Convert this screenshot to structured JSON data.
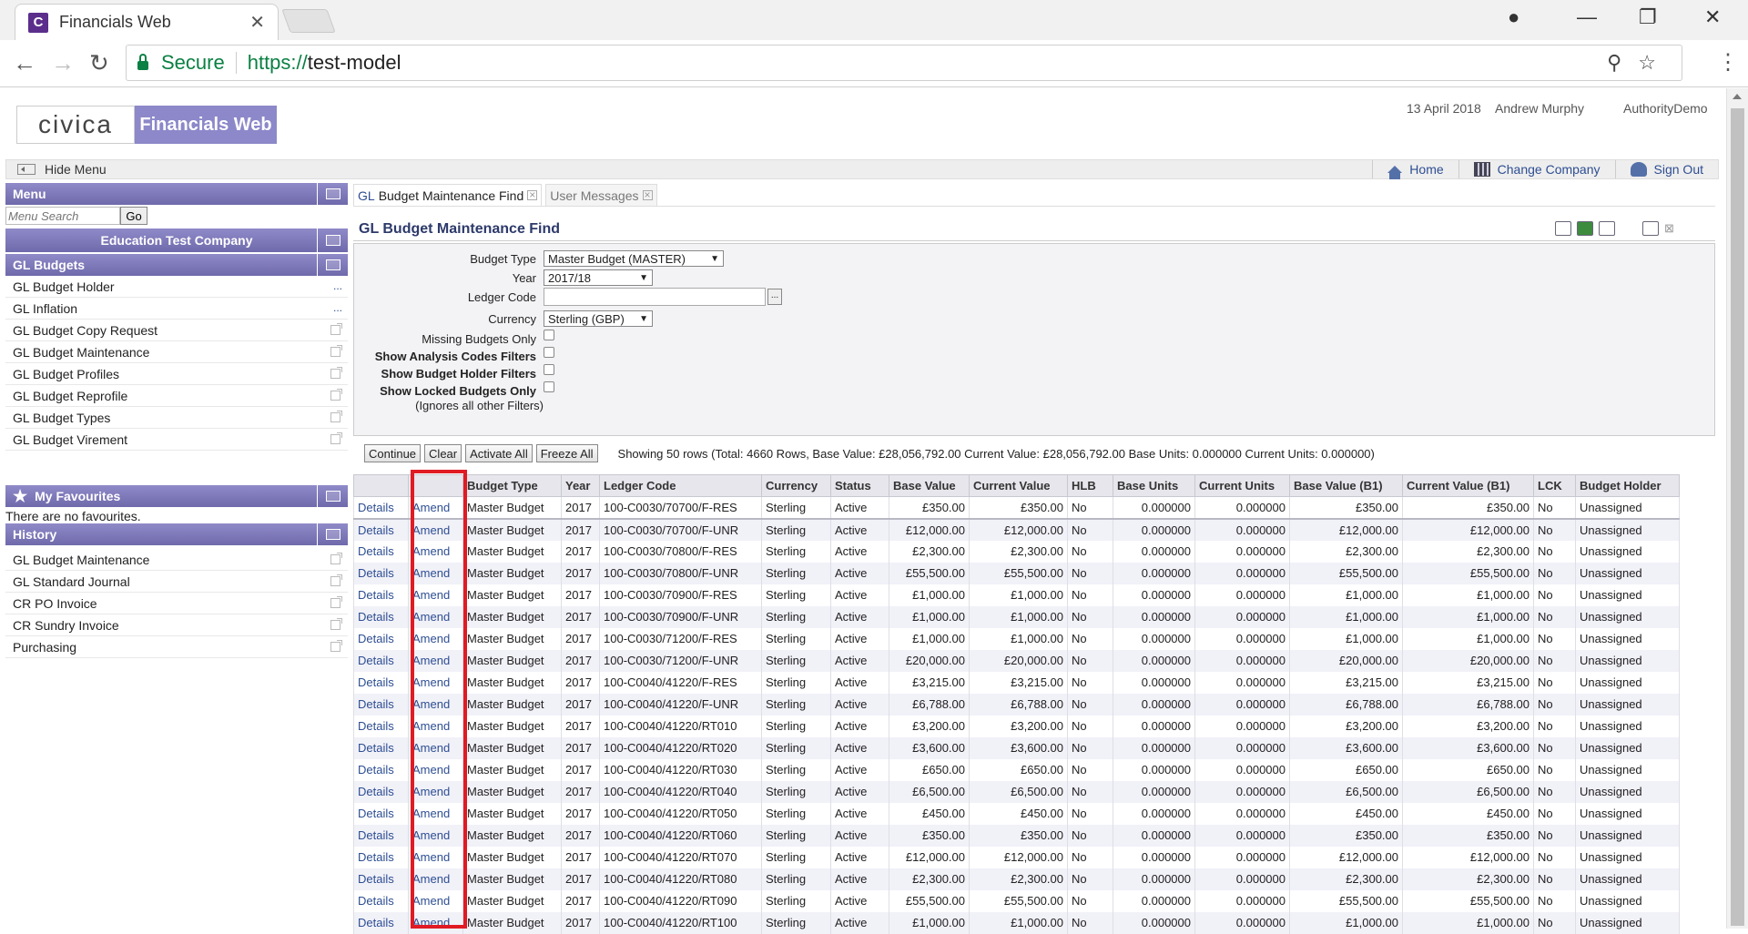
{
  "browser": {
    "tab_title": "Financials Web",
    "favicon_letter": "C",
    "secure_label": "Secure",
    "url_scheme": "https://",
    "url_host": "test-model"
  },
  "header": {
    "logo_text": "civica",
    "product_name": "Financials Web",
    "date": "13 April 2018",
    "user": "Andrew Murphy",
    "authority": "AuthorityDemo",
    "hide_menu": "Hide Menu",
    "links": {
      "home": "Home",
      "change_company": "Change Company",
      "sign_out": "Sign Out"
    }
  },
  "sidebar": {
    "menu_title": "Menu",
    "search_placeholder": "Menu Search",
    "go": "Go",
    "company": "Education Test Company",
    "group_title": "GL Budgets",
    "items": [
      {
        "label": "GL Budget Holder",
        "action": "..."
      },
      {
        "label": "GL Inflation",
        "action": "..."
      },
      {
        "label": "GL Budget Copy Request"
      },
      {
        "label": "GL Budget Maintenance"
      },
      {
        "label": "GL Budget Profiles"
      },
      {
        "label": "GL Budget Reprofile"
      },
      {
        "label": "GL Budget Types"
      },
      {
        "label": "GL Budget Virement"
      }
    ],
    "favourites_title": "My Favourites",
    "no_favourites": "There are no favourites.",
    "history_title": "History",
    "history": [
      "GL Budget Maintenance",
      "GL Standard Journal",
      "CR PO Invoice",
      "CR Sundry Invoice",
      "Purchasing"
    ]
  },
  "tabs": {
    "active_prefix": "GL",
    "active_label": "Budget Maintenance Find",
    "second": "User Messages"
  },
  "page_title": "GL Budget Maintenance Find",
  "form": {
    "budget_type_label": "Budget Type",
    "budget_type_value": "Master Budget (MASTER)",
    "year_label": "Year",
    "year_value": "2017/18",
    "ledger_code_label": "Ledger Code",
    "ledger_code_value": "",
    "currency_label": "Currency",
    "currency_value": "Sterling (GBP)",
    "missing_label": "Missing Budgets Only",
    "analysis_label": "Show Analysis Codes Filters",
    "holder_label": "Show Budget Holder Filters",
    "locked_label": "Show Locked Budgets Only",
    "ignore_note": "(Ignores all other Filters)"
  },
  "actions": {
    "continue": "Continue",
    "clear": "Clear",
    "activate_all": "Activate All",
    "freeze_all": "Freeze All",
    "summary": "Showing 50 rows (Total: 4660 Rows, Base Value: £28,056,792.00 Current Value: £28,056,792.00 Base Units: 0.000000 Current Units: 0.000000)"
  },
  "table": {
    "headers": [
      "",
      "",
      "Budget Type",
      "Year",
      "Ledger Code",
      "Currency",
      "Status",
      "Base Value",
      "Current Value",
      "HLB",
      "Base Units",
      "Current Units",
      "Base Value (B1)",
      "Current Value (B1)",
      "LCK",
      "Budget Holder"
    ],
    "details_label": "Details",
    "amend_label": "Amend",
    "rows": [
      [
        "Master Budget",
        "2017",
        "100-C0030/70700/F-RES",
        "Sterling",
        "Active",
        "£350.00",
        "£350.00",
        "No",
        "0.000000",
        "0.000000",
        "£350.00",
        "£350.00",
        "No",
        "Unassigned"
      ],
      [
        "Master Budget",
        "2017",
        "100-C0030/70700/F-UNR",
        "Sterling",
        "Active",
        "£12,000.00",
        "£12,000.00",
        "No",
        "0.000000",
        "0.000000",
        "£12,000.00",
        "£12,000.00",
        "No",
        "Unassigned"
      ],
      [
        "Master Budget",
        "2017",
        "100-C0030/70800/F-RES",
        "Sterling",
        "Active",
        "£2,300.00",
        "£2,300.00",
        "No",
        "0.000000",
        "0.000000",
        "£2,300.00",
        "£2,300.00",
        "No",
        "Unassigned"
      ],
      [
        "Master Budget",
        "2017",
        "100-C0030/70800/F-UNR",
        "Sterling",
        "Active",
        "£55,500.00",
        "£55,500.00",
        "No",
        "0.000000",
        "0.000000",
        "£55,500.00",
        "£55,500.00",
        "No",
        "Unassigned"
      ],
      [
        "Master Budget",
        "2017",
        "100-C0030/70900/F-RES",
        "Sterling",
        "Active",
        "£1,000.00",
        "£1,000.00",
        "No",
        "0.000000",
        "0.000000",
        "£1,000.00",
        "£1,000.00",
        "No",
        "Unassigned"
      ],
      [
        "Master Budget",
        "2017",
        "100-C0030/70900/F-UNR",
        "Sterling",
        "Active",
        "£1,000.00",
        "£1,000.00",
        "No",
        "0.000000",
        "0.000000",
        "£1,000.00",
        "£1,000.00",
        "No",
        "Unassigned"
      ],
      [
        "Master Budget",
        "2017",
        "100-C0030/71200/F-RES",
        "Sterling",
        "Active",
        "£1,000.00",
        "£1,000.00",
        "No",
        "0.000000",
        "0.000000",
        "£1,000.00",
        "£1,000.00",
        "No",
        "Unassigned"
      ],
      [
        "Master Budget",
        "2017",
        "100-C0030/71200/F-UNR",
        "Sterling",
        "Active",
        "£20,000.00",
        "£20,000.00",
        "No",
        "0.000000",
        "0.000000",
        "£20,000.00",
        "£20,000.00",
        "No",
        "Unassigned"
      ],
      [
        "Master Budget",
        "2017",
        "100-C0040/41220/F-RES",
        "Sterling",
        "Active",
        "£3,215.00",
        "£3,215.00",
        "No",
        "0.000000",
        "0.000000",
        "£3,215.00",
        "£3,215.00",
        "No",
        "Unassigned"
      ],
      [
        "Master Budget",
        "2017",
        "100-C0040/41220/F-UNR",
        "Sterling",
        "Active",
        "£6,788.00",
        "£6,788.00",
        "No",
        "0.000000",
        "0.000000",
        "£6,788.00",
        "£6,788.00",
        "No",
        "Unassigned"
      ],
      [
        "Master Budget",
        "2017",
        "100-C0040/41220/RT010",
        "Sterling",
        "Active",
        "£3,200.00",
        "£3,200.00",
        "No",
        "0.000000",
        "0.000000",
        "£3,200.00",
        "£3,200.00",
        "No",
        "Unassigned"
      ],
      [
        "Master Budget",
        "2017",
        "100-C0040/41220/RT020",
        "Sterling",
        "Active",
        "£3,600.00",
        "£3,600.00",
        "No",
        "0.000000",
        "0.000000",
        "£3,600.00",
        "£3,600.00",
        "No",
        "Unassigned"
      ],
      [
        "Master Budget",
        "2017",
        "100-C0040/41220/RT030",
        "Sterling",
        "Active",
        "£650.00",
        "£650.00",
        "No",
        "0.000000",
        "0.000000",
        "£650.00",
        "£650.00",
        "No",
        "Unassigned"
      ],
      [
        "Master Budget",
        "2017",
        "100-C0040/41220/RT040",
        "Sterling",
        "Active",
        "£6,500.00",
        "£6,500.00",
        "No",
        "0.000000",
        "0.000000",
        "£6,500.00",
        "£6,500.00",
        "No",
        "Unassigned"
      ],
      [
        "Master Budget",
        "2017",
        "100-C0040/41220/RT050",
        "Sterling",
        "Active",
        "£450.00",
        "£450.00",
        "No",
        "0.000000",
        "0.000000",
        "£450.00",
        "£450.00",
        "No",
        "Unassigned"
      ],
      [
        "Master Budget",
        "2017",
        "100-C0040/41220/RT060",
        "Sterling",
        "Active",
        "£350.00",
        "£350.00",
        "No",
        "0.000000",
        "0.000000",
        "£350.00",
        "£350.00",
        "No",
        "Unassigned"
      ],
      [
        "Master Budget",
        "2017",
        "100-C0040/41220/RT070",
        "Sterling",
        "Active",
        "£12,000.00",
        "£12,000.00",
        "No",
        "0.000000",
        "0.000000",
        "£12,000.00",
        "£12,000.00",
        "No",
        "Unassigned"
      ],
      [
        "Master Budget",
        "2017",
        "100-C0040/41220/RT080",
        "Sterling",
        "Active",
        "£2,300.00",
        "£2,300.00",
        "No",
        "0.000000",
        "0.000000",
        "£2,300.00",
        "£2,300.00",
        "No",
        "Unassigned"
      ],
      [
        "Master Budget",
        "2017",
        "100-C0040/41220/RT090",
        "Sterling",
        "Active",
        "£55,500.00",
        "£55,500.00",
        "No",
        "0.000000",
        "0.000000",
        "£55,500.00",
        "£55,500.00",
        "No",
        "Unassigned"
      ],
      [
        "Master Budget",
        "2017",
        "100-C0040/41220/RT100",
        "Sterling",
        "Active",
        "£1,000.00",
        "£1,000.00",
        "No",
        "0.000000",
        "0.000000",
        "£1,000.00",
        "£1,000.00",
        "No",
        "Unassigned"
      ]
    ]
  },
  "colors": {
    "accent": "#7c78bb",
    "link": "#2d4e92",
    "highlight": "#e01b24"
  }
}
